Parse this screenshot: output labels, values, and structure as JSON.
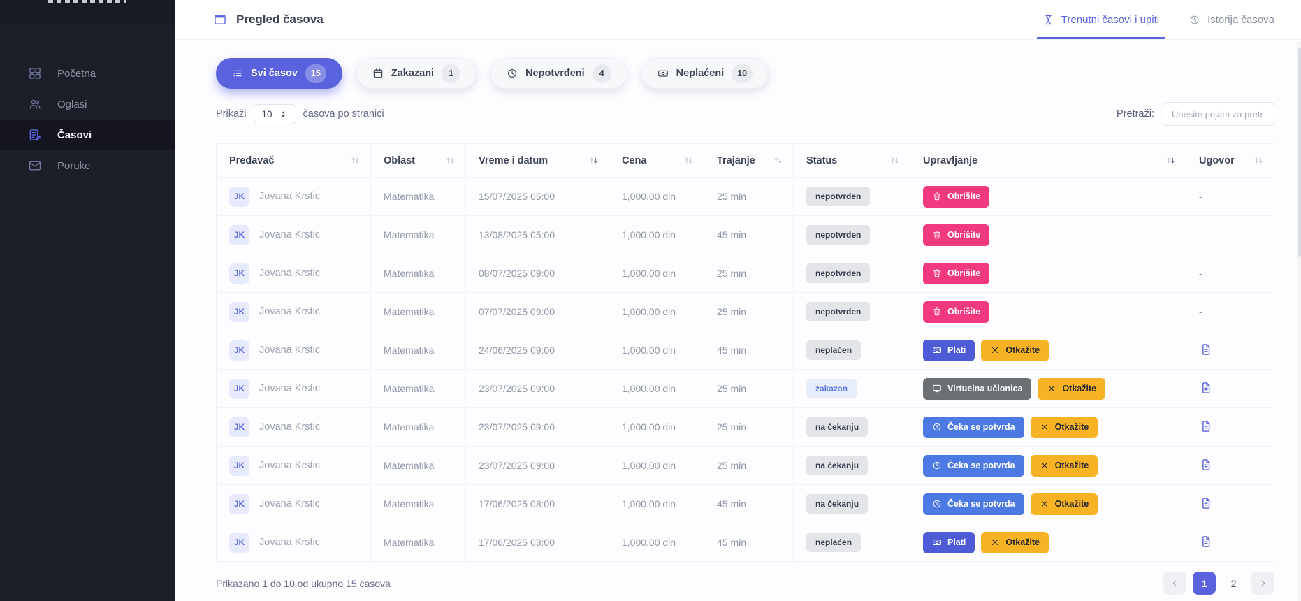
{
  "colors": {
    "accent_indigo": "#5a63dd",
    "tab_active_blue": "#5a66e0",
    "delete_pink": "#f1397f",
    "cancel_yellow": "#f8b324",
    "pay_indigo": "#4d5bd6",
    "confirm_blue": "#4d79e3",
    "virtual_class_gray": "#6d7073",
    "badge_gray_bg": "#e4e5e9",
    "badge_blue_bg": "#e8edfc",
    "sidebar_bg": "#1c1e28"
  },
  "sidebar": {
    "items": [
      {
        "label": "Početna",
        "icon": "grid-icon",
        "active": false
      },
      {
        "label": "Oglasi",
        "icon": "users-icon",
        "active": false
      },
      {
        "label": "Časovi",
        "icon": "lessons-icon",
        "active": true
      },
      {
        "label": "Poruke",
        "icon": "envelope-icon",
        "active": false
      }
    ]
  },
  "topbar": {
    "title": "Pregled časova",
    "title_icon": "calendar-window-icon",
    "tabs": [
      {
        "label": "Trenutni časovi i upiti",
        "icon": "hourglass-icon",
        "active": true
      },
      {
        "label": "Istorija časova",
        "icon": "history-icon",
        "active": false
      }
    ]
  },
  "filters": [
    {
      "label": "Svi časov",
      "count": "15",
      "icon": "list-icon",
      "active": true
    },
    {
      "label": "Zakazani",
      "count": "1",
      "icon": "calendar-icon",
      "active": false
    },
    {
      "label": "Nepotvrđeni",
      "count": "4",
      "icon": "clock-icon",
      "active": false
    },
    {
      "label": "Neplaćeni",
      "count": "10",
      "icon": "cash-icon",
      "active": false
    }
  ],
  "page_size": {
    "prefix": "Prikaži",
    "value": "10",
    "suffix": "časova po stranici"
  },
  "search": {
    "label": "Pretraži:",
    "placeholder": "Unesite pojam za pretr"
  },
  "table": {
    "columns": [
      {
        "label": "Predavač",
        "sorted": false
      },
      {
        "label": "Oblast",
        "sorted": false
      },
      {
        "label": "Vreme i datum",
        "sorted": true
      },
      {
        "label": "Cena",
        "sorted": false
      },
      {
        "label": "Trajanje",
        "sorted": false
      },
      {
        "label": "Status",
        "sorted": false
      },
      {
        "label": "Upravljanje",
        "sorted": true
      },
      {
        "label": "Ugovor",
        "sorted": false
      }
    ],
    "rows": [
      {
        "avatar": "JK",
        "teacher": "Jovana Krstic",
        "subject": "Matematika",
        "datetime": "15/07/2025 05:00",
        "price": "1,000.00 din",
        "duration": "25 min",
        "status": {
          "label": "nepotvrden",
          "type": "gray"
        },
        "actions": [
          {
            "label": "Obrišite",
            "type": "delete",
            "icon": "trash-icon"
          }
        ],
        "contract": {
          "type": "dash",
          "value": "-"
        }
      },
      {
        "avatar": "JK",
        "teacher": "Jovana Krstic",
        "subject": "Matematika",
        "datetime": "13/08/2025 05:00",
        "price": "1,000.00 din",
        "duration": "45 min",
        "status": {
          "label": "nepotvrden",
          "type": "gray"
        },
        "actions": [
          {
            "label": "Obrišite",
            "type": "delete",
            "icon": "trash-icon"
          }
        ],
        "contract": {
          "type": "dash",
          "value": "-"
        }
      },
      {
        "avatar": "JK",
        "teacher": "Jovana Krstic",
        "subject": "Matematika",
        "datetime": "08/07/2025 09:00",
        "price": "1,000.00 din",
        "duration": "25 min",
        "status": {
          "label": "nepotvrden",
          "type": "gray"
        },
        "actions": [
          {
            "label": "Obrišite",
            "type": "delete",
            "icon": "trash-icon"
          }
        ],
        "contract": {
          "type": "dash",
          "value": "-"
        }
      },
      {
        "avatar": "JK",
        "teacher": "Jovana Krstic",
        "subject": "Matematika",
        "datetime": "07/07/2025 09:00",
        "price": "1,000.00 din",
        "duration": "25 min",
        "status": {
          "label": "nepotvrden",
          "type": "gray"
        },
        "actions": [
          {
            "label": "Obrišite",
            "type": "delete",
            "icon": "trash-icon"
          }
        ],
        "contract": {
          "type": "dash",
          "value": "-"
        }
      },
      {
        "avatar": "JK",
        "teacher": "Jovana Krstic",
        "subject": "Matematika",
        "datetime": "24/06/2025 09:00",
        "price": "1,000.00 din",
        "duration": "45 min",
        "status": {
          "label": "neplaćen",
          "type": "gray"
        },
        "actions": [
          {
            "label": "Plati",
            "type": "pay",
            "icon": "cash-icon"
          },
          {
            "label": "Otkažite",
            "type": "cancel",
            "icon": "x-icon"
          }
        ],
        "contract": {
          "type": "doc",
          "icon": "document-icon"
        }
      },
      {
        "avatar": "JK",
        "teacher": "Jovana Krstic",
        "subject": "Matematika",
        "datetime": "23/07/2025 09:00",
        "price": "1,000.00 din",
        "duration": "25 min",
        "status": {
          "label": "zakazan",
          "type": "blue"
        },
        "actions": [
          {
            "label": "Virtuelna učionica",
            "type": "vclass",
            "icon": "monitor-icon"
          },
          {
            "label": "Otkažite",
            "type": "cancel",
            "icon": "x-icon"
          }
        ],
        "contract": {
          "type": "doc",
          "icon": "document-icon"
        }
      },
      {
        "avatar": "JK",
        "teacher": "Jovana Krstic",
        "subject": "Matematika",
        "datetime": "23/07/2025 09:00",
        "price": "1,000.00 din",
        "duration": "25 min",
        "status": {
          "label": "na čekanju",
          "type": "gray"
        },
        "actions": [
          {
            "label": "Čeka se potvrda",
            "type": "wait",
            "icon": "clock-icon"
          },
          {
            "label": "Otkažite",
            "type": "cancel",
            "icon": "x-icon"
          }
        ],
        "contract": {
          "type": "doc",
          "icon": "document-icon"
        }
      },
      {
        "avatar": "JK",
        "teacher": "Jovana Krstic",
        "subject": "Matematika",
        "datetime": "23/07/2025 09:00",
        "price": "1,000.00 din",
        "duration": "25 min",
        "status": {
          "label": "na čekanju",
          "type": "gray"
        },
        "actions": [
          {
            "label": "Čeka se potvrda",
            "type": "wait",
            "icon": "clock-icon"
          },
          {
            "label": "Otkažite",
            "type": "cancel",
            "icon": "x-icon"
          }
        ],
        "contract": {
          "type": "doc",
          "icon": "document-icon"
        }
      },
      {
        "avatar": "JK",
        "teacher": "Jovana Krstic",
        "subject": "Matematika",
        "datetime": "17/06/2025 08:00",
        "price": "1,000.00 din",
        "duration": "45 min",
        "status": {
          "label": "na čekanju",
          "type": "gray"
        },
        "actions": [
          {
            "label": "Čeka se potvrda",
            "type": "wait",
            "icon": "clock-icon"
          },
          {
            "label": "Otkažite",
            "type": "cancel",
            "icon": "x-icon"
          }
        ],
        "contract": {
          "type": "doc",
          "icon": "document-icon"
        }
      },
      {
        "avatar": "JK",
        "teacher": "Jovana Krstic",
        "subject": "Matematika",
        "datetime": "17/06/2025 03:00",
        "price": "1,000.00 din",
        "duration": "45 min",
        "status": {
          "label": "neplaćen",
          "type": "gray"
        },
        "actions": [
          {
            "label": "Plati",
            "type": "pay",
            "icon": "cash-icon"
          },
          {
            "label": "Otkažite",
            "type": "cancel",
            "icon": "x-icon"
          }
        ],
        "contract": {
          "type": "doc",
          "icon": "document-icon"
        }
      }
    ]
  },
  "footer": {
    "summary": "Prikazano 1 do 10 od ukupno 15 časova",
    "pagination": {
      "pages": [
        "1",
        "2"
      ],
      "active_page": "1"
    }
  }
}
